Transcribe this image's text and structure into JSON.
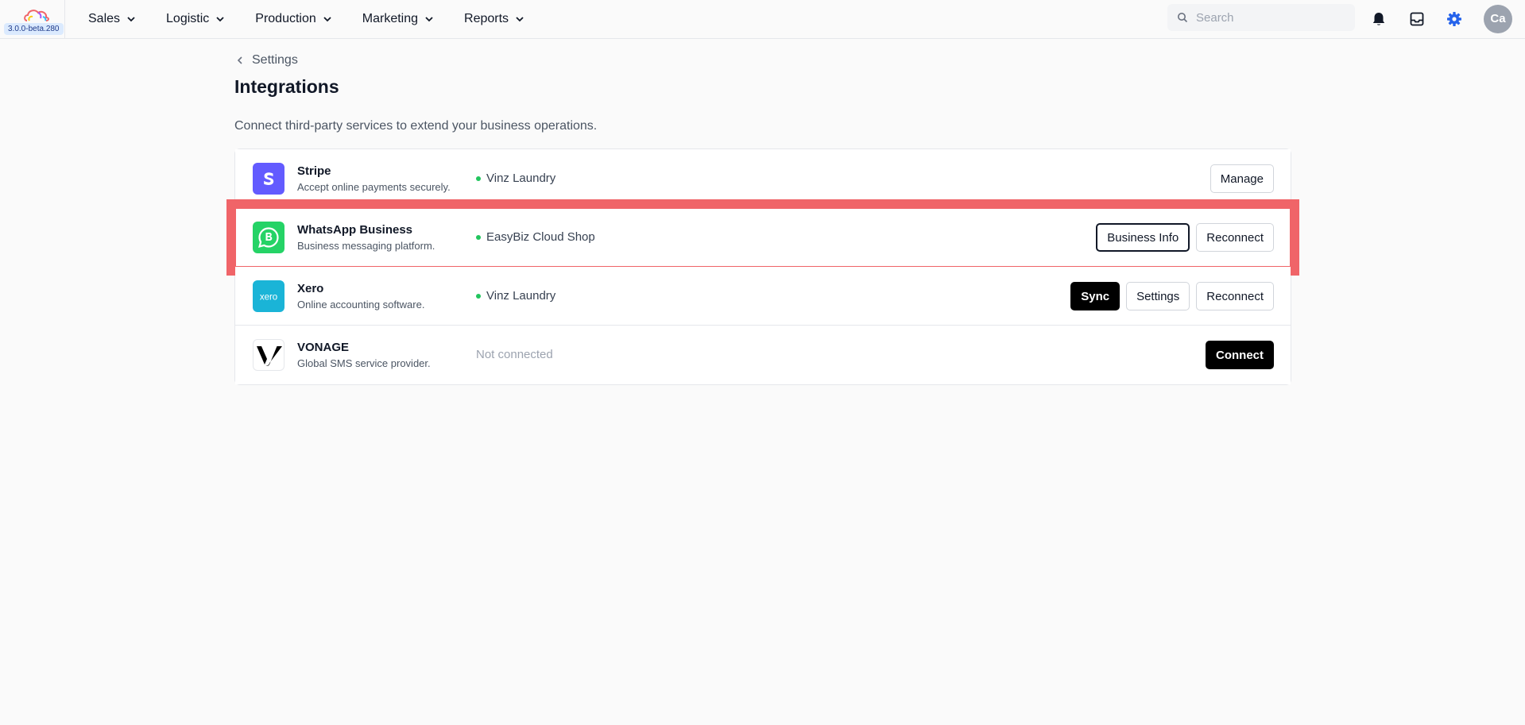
{
  "app": {
    "version": "3.0.0-beta.280"
  },
  "nav": {
    "items": [
      {
        "label": "Sales"
      },
      {
        "label": "Logistic"
      },
      {
        "label": "Production"
      },
      {
        "label": "Marketing"
      },
      {
        "label": "Reports"
      }
    ]
  },
  "search": {
    "placeholder": "Search"
  },
  "header_icons": [
    "bell-icon",
    "inbox-icon",
    "gear-icon"
  ],
  "user": {
    "initials": "Ca"
  },
  "page": {
    "breadcrumb": "Settings",
    "title": "Integrations",
    "description": "Connect third-party services to extend your business operations."
  },
  "integrations": [
    {
      "name": "Stripe",
      "description": "Accept online payments securely.",
      "status": "Vinz Laundry",
      "connected": true,
      "logo": "stripe-logo",
      "actions": [
        "Manage"
      ]
    },
    {
      "name": "WhatsApp Business",
      "description": "Business messaging platform.",
      "status": "EasyBiz Cloud Shop",
      "connected": true,
      "highlighted": true,
      "logo": "whatsapp-business-logo",
      "actions": [
        "Business Info",
        "Reconnect"
      ]
    },
    {
      "name": "Xero",
      "description": "Online accounting software.",
      "status": "Vinz Laundry",
      "connected": true,
      "logo": "xero-logo",
      "logo_text": "xero",
      "actions": [
        "Sync",
        "Settings",
        "Reconnect"
      ]
    },
    {
      "name": "VONAGE",
      "description": "Global SMS service provider.",
      "status": "Not connected",
      "connected": false,
      "logo": "vonage-logo",
      "actions": [
        "Connect"
      ]
    }
  ],
  "colors": {
    "accent": "#2563eb",
    "highlight": "#f06468",
    "status_dot": "#22c55e",
    "stripe": "#635bff",
    "whatsapp": "#25d366",
    "xero": "#1ab4d7",
    "dark_button": "#000000"
  }
}
